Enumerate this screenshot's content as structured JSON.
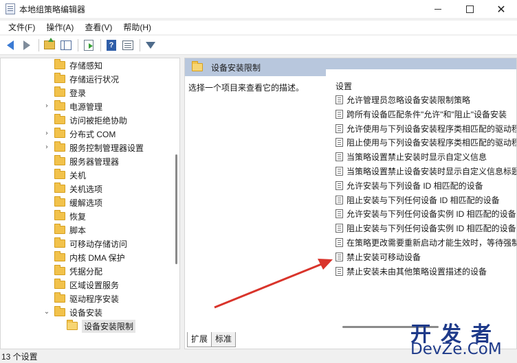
{
  "window": {
    "title": "本地组策略编辑器",
    "minimize": "",
    "maximize": "",
    "close": "✕"
  },
  "menu": [
    "文件(F)",
    "操作(A)",
    "查看(V)",
    "帮助(H)"
  ],
  "toolbar": {
    "icons": [
      "back-arrow-icon",
      "forward-arrow-icon",
      "folder-up-icon",
      "show-hide-tree-icon",
      "export-list-icon",
      "help-icon",
      "properties-icon",
      "filter-icon"
    ],
    "help_glyph": "?"
  },
  "tree": {
    "items": [
      {
        "label": "存储感知",
        "expandable": false
      },
      {
        "label": "存储运行状况",
        "expandable": false
      },
      {
        "label": "登录",
        "expandable": false
      },
      {
        "label": "电源管理",
        "expandable": true
      },
      {
        "label": "访问被拒绝协助",
        "expandable": false
      },
      {
        "label": "分布式 COM",
        "expandable": true
      },
      {
        "label": "服务控制管理器设置",
        "expandable": true
      },
      {
        "label": "服务器管理器",
        "expandable": false
      },
      {
        "label": "关机",
        "expandable": false
      },
      {
        "label": "关机选项",
        "expandable": false
      },
      {
        "label": "缓解选项",
        "expandable": false
      },
      {
        "label": "恢复",
        "expandable": false
      },
      {
        "label": "脚本",
        "expandable": false
      },
      {
        "label": "可移动存储访问",
        "expandable": false
      },
      {
        "label": "内核 DMA 保护",
        "expandable": false
      },
      {
        "label": "凭据分配",
        "expandable": false
      },
      {
        "label": "区域设置服务",
        "expandable": false
      },
      {
        "label": "驱动程序安装",
        "expandable": false
      },
      {
        "label": "设备安装",
        "expandable": true,
        "expanded": true
      },
      {
        "label": "设备安装限制",
        "expandable": false,
        "selected": true,
        "child": true
      }
    ],
    "expand_glyph": "›",
    "expanded_glyph": "⌄"
  },
  "right": {
    "header_title": "设备安装限制",
    "description": "选择一个项目来查看它的描述。",
    "column_header": "设置",
    "settings": [
      "允许管理员忽略设备安装限制策略",
      "跨所有设备匹配条件\"允许\"和\"阻止\"设备安装",
      "允许使用与下列设备安装程序类相匹配的驱动程",
      "阻止使用与下列设备安装程序类相匹配的驱动程",
      "当策略设置禁止安装时显示自定义信息",
      "当策略设置禁止设备安装时显示自定义信息标题",
      "允许安装与下列设备 ID 相匹配的设备",
      "阻止安装与下列任何设备 ID 相匹配的设备",
      "允许安装与下列任何设备实例 ID 相匹配的设备",
      "阻止安装与下列任何设备实例 ID 相匹配的设备",
      "在策略更改需要重新启动才能生效时，等待强制",
      "禁止安装可移动设备",
      "禁止安装未由其他策略设置描述的设备"
    ]
  },
  "tabs": [
    "扩展",
    "标准"
  ],
  "status": "13 个设置",
  "watermark": {
    "line1": "开发者",
    "line2": "DevZe.CoM"
  },
  "colors": {
    "header_bg": "#b8c7dd",
    "annotation_arrow": "#d9342b",
    "watermark": "#1e3a8a"
  }
}
